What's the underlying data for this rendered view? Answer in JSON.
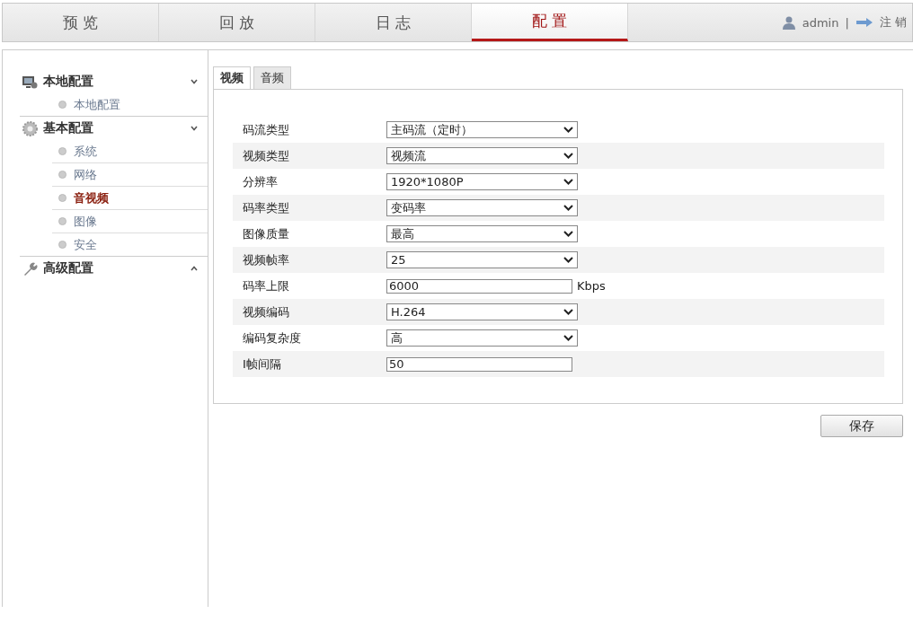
{
  "nav": {
    "tabs": [
      {
        "label": "预 览",
        "selected": false
      },
      {
        "label": "回 放",
        "selected": false
      },
      {
        "label": "日 志",
        "selected": false
      },
      {
        "label": "配 置",
        "selected": true
      }
    ],
    "user": "admin",
    "separator": "|",
    "logout": "注 销"
  },
  "sidebar": {
    "groups": [
      {
        "title": "本地配置",
        "kind": "monitor",
        "expanded": true,
        "items": [
          {
            "label": "本地配置",
            "selected": false
          }
        ]
      },
      {
        "title": "基本配置",
        "kind": "gear",
        "expanded": true,
        "items": [
          {
            "label": "系统",
            "selected": false
          },
          {
            "label": "网络",
            "selected": false
          },
          {
            "label": "音视频",
            "selected": true
          },
          {
            "label": "图像",
            "selected": false
          },
          {
            "label": "安全",
            "selected": false
          }
        ]
      },
      {
        "title": "高级配置",
        "kind": "wrench",
        "expanded": false
      }
    ]
  },
  "tabs": [
    {
      "label": "视频",
      "selected": true
    },
    {
      "label": "音频",
      "selected": false
    }
  ],
  "form": [
    {
      "label": "码流类型",
      "kind": "select",
      "value": "主码流（定时）"
    },
    {
      "label": "视频类型",
      "kind": "select",
      "value": "视频流"
    },
    {
      "label": "分辨率",
      "kind": "select",
      "value": "1920*1080P"
    },
    {
      "label": "码率类型",
      "kind": "select",
      "value": "变码率"
    },
    {
      "label": "图像质量",
      "kind": "select",
      "value": "最高"
    },
    {
      "label": "视频帧率",
      "kind": "select",
      "value": "25"
    },
    {
      "label": "码率上限",
      "kind": "text",
      "value": "6000",
      "unit": "Kbps"
    },
    {
      "label": "视频编码",
      "kind": "select",
      "value": "H.264"
    },
    {
      "label": "编码复杂度",
      "kind": "select",
      "value": "高"
    },
    {
      "label": "I帧间隔",
      "kind": "text",
      "value": "50"
    }
  ],
  "save": "保存"
}
